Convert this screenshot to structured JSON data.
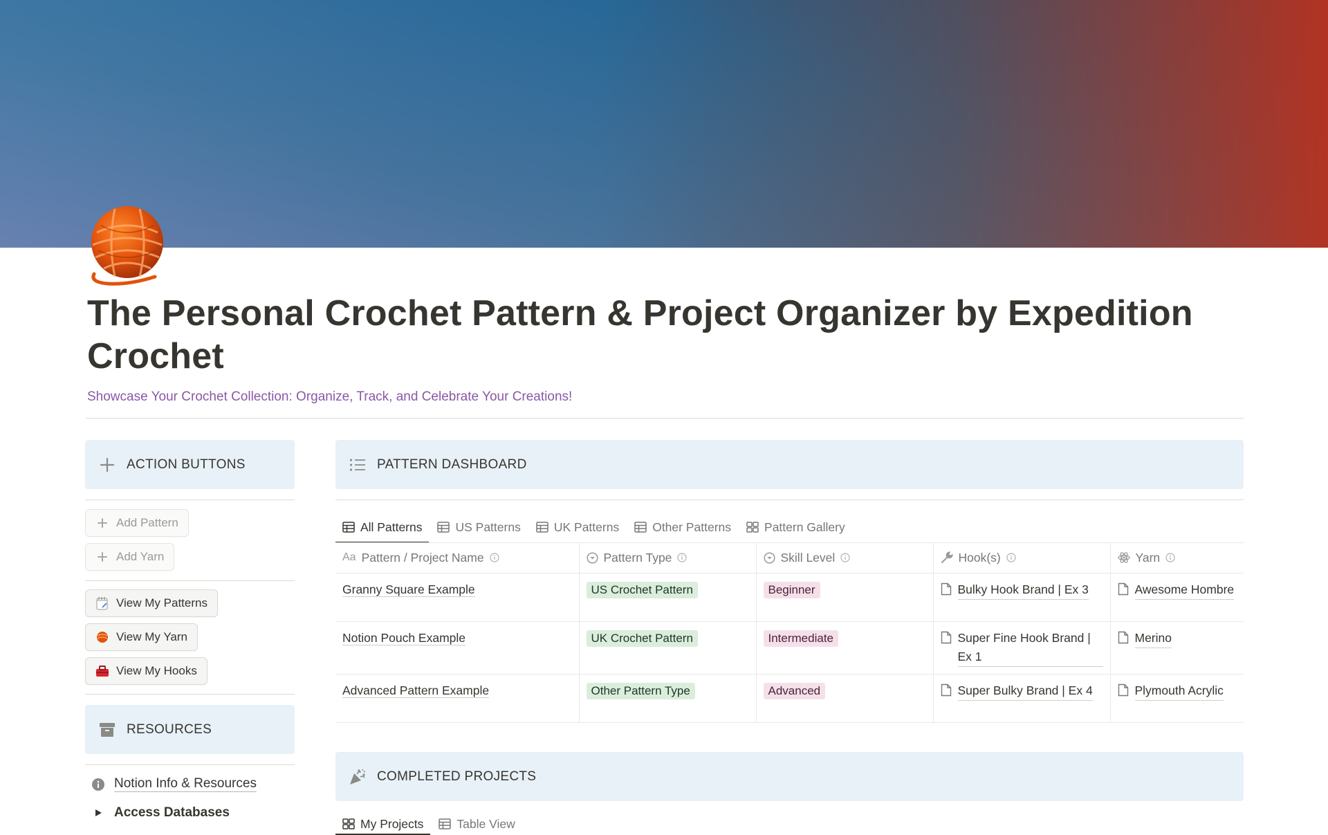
{
  "page": {
    "title": "The Personal Crochet Pattern & Project Organizer by Expedition Crochet",
    "subtitle": "Showcase Your Crochet Collection: Organize, Track, and Celebrate Your Creations!",
    "icon": "yarn-ball-icon"
  },
  "sidebar": {
    "action_header": "ACTION BUTTONS",
    "action_icon": "plus-icon",
    "buttons": [
      {
        "label": "Add Pattern",
        "icon": "plus-icon"
      },
      {
        "label": "Add Yarn",
        "icon": "plus-icon"
      },
      {
        "label": "View My Patterns",
        "icon": "notepad-icon"
      },
      {
        "label": "View My Yarn",
        "icon": "yarn-ball-icon"
      },
      {
        "label": "View My Hooks",
        "icon": "toolbox-icon"
      }
    ],
    "resources_header": "RESOURCES",
    "resources_icon": "archive-box-icon",
    "resources": [
      {
        "label": "Notion Info & Resources",
        "icon": "info-icon"
      },
      {
        "label": "Access Databases",
        "icon": "triangle-right-icon"
      }
    ]
  },
  "dashboard": {
    "header": "PATTERN DASHBOARD",
    "header_icon": "bulleted-list-icon",
    "tabs": [
      {
        "label": "All Patterns",
        "icon": "table-icon",
        "active": true
      },
      {
        "label": "US Patterns",
        "icon": "table-icon"
      },
      {
        "label": "UK Patterns",
        "icon": "table-icon"
      },
      {
        "label": "Other Patterns",
        "icon": "table-icon"
      },
      {
        "label": "Pattern Gallery",
        "icon": "gallery-icon"
      }
    ],
    "columns": [
      "Pattern / Project Name",
      "Pattern Type",
      "Skill Level",
      "Hook(s)",
      "Yarn"
    ],
    "rows": [
      {
        "name": "Granny Square Example",
        "type": "US Crochet Pattern",
        "skill": "Beginner",
        "hook": "Bulky Hook Brand | Ex 3",
        "yarn": "Awesome Hombre"
      },
      {
        "name": "Notion Pouch Example",
        "type": "UK Crochet Pattern",
        "skill": "Intermediate",
        "hook": "Super Fine Hook Brand | Ex 1",
        "yarn": "Merino"
      },
      {
        "name": "Advanced Pattern Example",
        "type": "Other Pattern Type",
        "skill": "Advanced",
        "hook": "Super Bulky Brand | Ex 4",
        "yarn": "Plymouth Acrylic"
      }
    ],
    "colors": {
      "tag_green": "#dbeddb",
      "tag_pink": "#f5e0e9"
    }
  },
  "completed": {
    "header": "COMPLETED PROJECTS",
    "header_icon": "party-popper-icon",
    "tabs": [
      {
        "label": "My Projects",
        "icon": "gallery-icon",
        "active": true
      },
      {
        "label": "Table View",
        "icon": "table-icon"
      }
    ]
  },
  "colors": {
    "callout_bg": "#e8f1f8",
    "subtitle": "#8a58a8",
    "text": "#37352f"
  }
}
